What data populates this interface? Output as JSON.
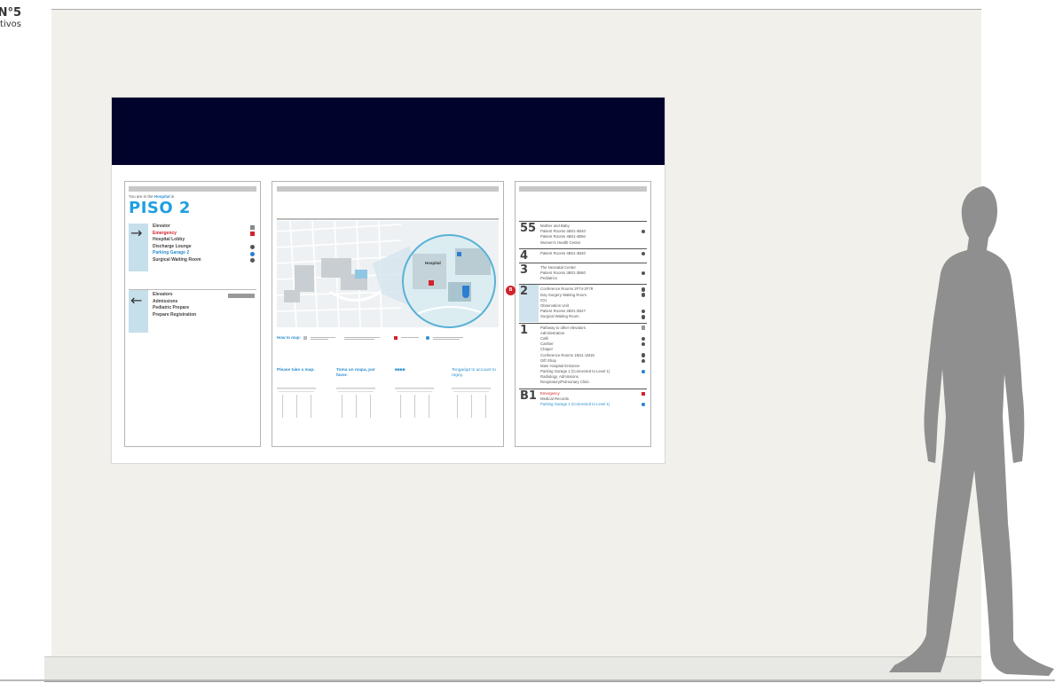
{
  "corner": {
    "number": "N°5",
    "caption": "ativos"
  },
  "left_panel": {
    "intro_prefix": "You are in the",
    "intro_place": "Hospital",
    "intro_suffix": "in",
    "floor_title": "PISO 2",
    "right_group": [
      {
        "label": "Elevator",
        "style": "plain",
        "icon": "elevator-icon"
      },
      {
        "label": "Emergency",
        "style": "red",
        "icon": "emergency-cross-icon"
      },
      {
        "label": "Hospital Lobby",
        "style": "plain",
        "icon": ""
      },
      {
        "label": "Discharge Lounge",
        "style": "plain",
        "icon": "info-icon"
      },
      {
        "label": "Parking Garage 2",
        "style": "blue",
        "icon": "parking-icon"
      },
      {
        "label": "Surgical Waiting Room",
        "style": "plain",
        "icon": "info-icon"
      }
    ],
    "left_group": [
      {
        "label": "Elevators",
        "style": "plain",
        "icon": "elevator-bank-icon"
      },
      {
        "label": "Admissions",
        "style": "plain",
        "icon": ""
      },
      {
        "label": "Pediatric Prepare",
        "style": "plain",
        "icon": ""
      },
      {
        "label": "Prepare Registration",
        "style": "plain",
        "icon": ""
      }
    ],
    "right_arrow": "→",
    "left_arrow": "←"
  },
  "middle_panel": {
    "map_callout": "Hospital",
    "legend_label": "How to map:",
    "tips": [
      {
        "text": "Please take a map.",
        "style": "bold"
      },
      {
        "text": "Toma un mapa, por favor.",
        "style": "bold"
      },
      {
        "text": "■■■■",
        "style": "bold"
      },
      {
        "text": "Tenga/apt to account to regny.",
        "style": "plain"
      }
    ]
  },
  "right_panel": {
    "floors": [
      {
        "num": "55",
        "items": [
          {
            "label": "Mother and Baby",
            "style": "plain",
            "icon": ""
          },
          {
            "label": "Patient Rooms 4B01-4B40",
            "style": "plain",
            "icon": "info-icon"
          },
          {
            "label": "Patient Rooms 4B01-4B60",
            "style": "plain",
            "icon": ""
          },
          {
            "label": "Women's Health Center",
            "style": "plain",
            "icon": ""
          }
        ]
      },
      {
        "num": "4",
        "items": [
          {
            "label": "Patient Rooms 4B01-4B40",
            "style": "plain",
            "icon": "info-icon"
          }
        ]
      },
      {
        "num": "3",
        "items": [
          {
            "label": "The Neonatal Center",
            "style": "plain",
            "icon": ""
          },
          {
            "label": "Patient Rooms 3B01-3B60",
            "style": "plain",
            "icon": "info-icon"
          },
          {
            "label": "Pediatrics",
            "style": "plain",
            "icon": ""
          }
        ]
      },
      {
        "num": "2",
        "here": true,
        "items": [
          {
            "label": "Conference Rooms 2F74-2F78",
            "style": "plain",
            "icon": "info-icon"
          },
          {
            "label": "Day Surgery Waiting Room",
            "style": "plain",
            "icon": "info-icon"
          },
          {
            "label": "ICU",
            "style": "plain",
            "icon": ""
          },
          {
            "label": "Observation Unit",
            "style": "plain",
            "icon": ""
          },
          {
            "label": "Patient Rooms 2B01-2B47",
            "style": "plain",
            "icon": "info-icon"
          },
          {
            "label": "Surgical Waiting Room",
            "style": "plain",
            "icon": "info-icon"
          }
        ]
      },
      {
        "num": "1",
        "items": [
          {
            "label": "Pathway to other elevators",
            "style": "plain",
            "icon": "elevator-bank-icon"
          },
          {
            "label": "Administration",
            "style": "plain",
            "icon": ""
          },
          {
            "label": "Café",
            "style": "plain",
            "icon": "info-icon"
          },
          {
            "label": "Cashier",
            "style": "plain",
            "icon": "info-icon"
          },
          {
            "label": "Chapel",
            "style": "plain",
            "icon": ""
          },
          {
            "label": "Conference Rooms 1M11-1M18",
            "style": "plain",
            "icon": "info-icon"
          },
          {
            "label": "Gift Shop",
            "style": "plain",
            "icon": "info-icon"
          },
          {
            "label": "Main Hospital Entrance",
            "style": "plain",
            "icon": ""
          },
          {
            "label": "Parking Garage 1 (Connected to Level 1)",
            "style": "plain",
            "icon": "parking-icon"
          },
          {
            "label": "Radiology, Admissions",
            "style": "plain",
            "icon": ""
          },
          {
            "label": "Respiratory/Pulmonary Clinic",
            "style": "plain",
            "icon": ""
          }
        ]
      },
      {
        "num": "B1",
        "items": [
          {
            "label": "Emergency",
            "style": "red",
            "icon": "emergency-cross-icon"
          },
          {
            "label": "Medical Records",
            "style": "plain",
            "icon": ""
          },
          {
            "label": "Parking Garage 1 (Connected to Level 1)",
            "style": "blue",
            "icon": "parking-icon"
          }
        ]
      }
    ],
    "here_badge": "B"
  },
  "colors": {
    "header_band": "#02032d",
    "wall": "#f1f0ea",
    "accent_blue": "#1e9fe1",
    "accent_red": "#d2232a",
    "silhouette": "#8f8f8f"
  }
}
